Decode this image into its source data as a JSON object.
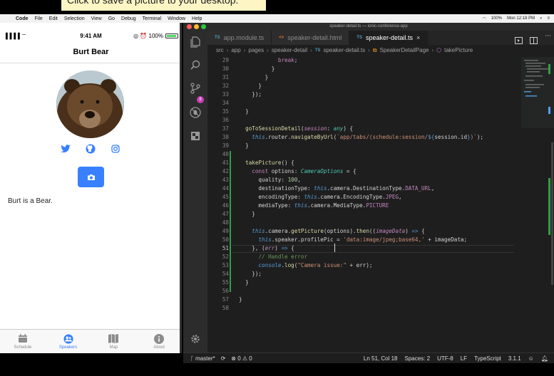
{
  "banner": {
    "text": "Click to save a picture to your desktop."
  },
  "menubar": {
    "app": "Code",
    "items": [
      "File",
      "Edit",
      "Selection",
      "View",
      "Go",
      "Debug",
      "Terminal",
      "Window",
      "Help"
    ],
    "battery": "100%",
    "clock": "Mon 12:18 PM"
  },
  "phone": {
    "carrier": "▐▐▐▐ ⌔",
    "time": "9:41 AM",
    "status_right": "◎ ⏰ 100%",
    "title": "Burt Bear",
    "social": [
      "twitter-icon",
      "github-icon",
      "instagram-icon"
    ],
    "bio": "Burt is a Bear.",
    "tabs": [
      {
        "label": "Schedule",
        "icon": "calendar-icon",
        "active": false
      },
      {
        "label": "Speakers",
        "icon": "people-icon",
        "active": true
      },
      {
        "label": "Map",
        "icon": "map-icon",
        "active": false
      },
      {
        "label": "About",
        "icon": "info-icon",
        "active": false
      }
    ],
    "accent": "#3880ff"
  },
  "vscode": {
    "window_title": "speaker-detail.ts — ionic-conference-app",
    "tabs": [
      {
        "icon": "TS",
        "label": "app.module.ts",
        "active": false
      },
      {
        "icon": "<>",
        "label": "speaker-detail.html",
        "active": false
      },
      {
        "icon": "TS",
        "label": "speaker-detail.ts",
        "active": true
      }
    ],
    "breadcrumbs": [
      "src",
      "app",
      "pages",
      "speaker-detail",
      "speaker-detail.ts",
      "SpeakerDetailPage",
      "takePicture"
    ],
    "line_numbers": [
      "29",
      "30",
      "31",
      "32",
      "33",
      "34",
      "35",
      "36",
      "37",
      "38",
      "39",
      "40",
      "41",
      "42",
      "43",
      "44",
      "45",
      "46",
      "47",
      "48",
      "49",
      "50",
      "51",
      "52",
      "53",
      "54",
      "55",
      "56",
      "57",
      "58"
    ],
    "current_line": "51",
    "status": {
      "branch": "master*",
      "problems": "⊗ 0 ⚠ 0",
      "position": "Ln 51, Col 18",
      "spaces": "Spaces: 2",
      "encoding": "UTF-8",
      "eol": "LF",
      "language": "TypeScript",
      "version": "3.1.1"
    }
  }
}
